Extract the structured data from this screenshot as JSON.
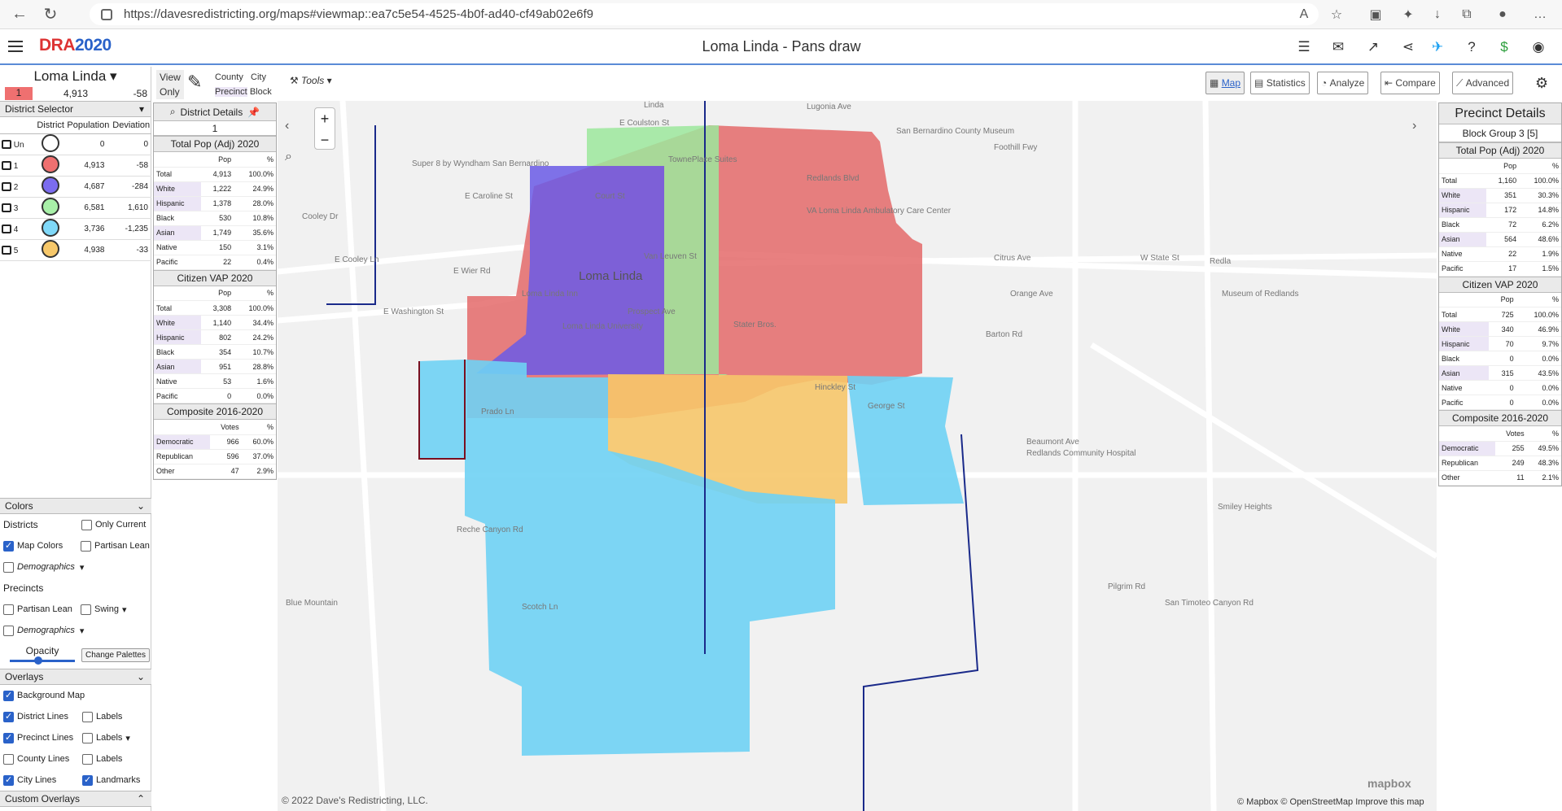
{
  "browser": {
    "url": "https://davesredistricting.org/maps#viewmap::ea7c5e54-4525-4b0f-ad40-cf49ab02e6f9"
  },
  "app": {
    "logo_main": "DRA",
    "logo_year": "2020",
    "title": "Loma Linda - Pans draw"
  },
  "left": {
    "district_name": "Loma Linda",
    "selected_district": "1",
    "selected_pop": "4,913",
    "selected_dev": "-58",
    "selector_title": "District Selector",
    "col_district": "District",
    "col_population": "Population",
    "col_deviation": "Deviation",
    "districts": [
      {
        "id": "Un",
        "pop": "0",
        "dev": "0",
        "color": "#ffffff"
      },
      {
        "id": "1",
        "pop": "4,913",
        "dev": "-58",
        "color": "#ef7070"
      },
      {
        "id": "2",
        "pop": "4,687",
        "dev": "-284",
        "color": "#7b6cf0"
      },
      {
        "id": "3",
        "pop": "6,581",
        "dev": "1,610",
        "color": "#a8f0a8"
      },
      {
        "id": "4",
        "pop": "3,736",
        "dev": "-1,235",
        "color": "#7fd8f8"
      },
      {
        "id": "5",
        "pop": "4,938",
        "dev": "-33",
        "color": "#f7c86a"
      }
    ]
  },
  "colors": {
    "title": "Colors",
    "districts_label": "Districts",
    "only_current": "Only Current",
    "map_colors": "Map Colors",
    "partisan_lean": "Partisan Lean",
    "demographics": "Demographics",
    "precincts_label": "Precincts",
    "p_partisan_lean": "Partisan Lean",
    "swing": "Swing",
    "p_demographics": "Demographics",
    "opacity": "Opacity",
    "change_palettes": "Change Palettes"
  },
  "overlays": {
    "title": "Overlays",
    "background_map": "Background Map",
    "district_lines": "District Lines",
    "labels1": "Labels",
    "precinct_lines": "Precinct Lines",
    "labels2": "Labels",
    "county_lines": "County Lines",
    "labels3": "Labels",
    "city_lines": "City Lines",
    "landmarks": "Landmarks",
    "custom_overlays": "Custom Overlays"
  },
  "toolbar": {
    "view": "View",
    "only": "Only",
    "county": "County",
    "city": "City",
    "precinct": "Precinct",
    "block": "Block",
    "tools": "Tools",
    "map": "Map",
    "statistics": "Statistics",
    "analyze": "Analyze",
    "compare": "Compare",
    "advanced": "Advanced"
  },
  "district_details": {
    "title": "District Details",
    "district": "1",
    "totalpop_title": "Total Pop (Adj) 2020",
    "vap_title": "Citizen VAP 2020",
    "composite_title": "Composite 2016-2020",
    "pop_h": "Pop",
    "pct_h": "%",
    "votes_h": "Votes",
    "totalpop": [
      {
        "k": "Total",
        "v": "4,913",
        "p": "100.0%"
      },
      {
        "k": "White",
        "v": "1,222",
        "p": "24.9%"
      },
      {
        "k": "Hispanic",
        "v": "1,378",
        "p": "28.0%"
      },
      {
        "k": "Black",
        "v": "530",
        "p": "10.8%"
      },
      {
        "k": "Asian",
        "v": "1,749",
        "p": "35.6%"
      },
      {
        "k": "Native",
        "v": "150",
        "p": "3.1%"
      },
      {
        "k": "Pacific",
        "v": "22",
        "p": "0.4%"
      }
    ],
    "vap": [
      {
        "k": "Total",
        "v": "3,308",
        "p": "100.0%"
      },
      {
        "k": "White",
        "v": "1,140",
        "p": "34.4%"
      },
      {
        "k": "Hispanic",
        "v": "802",
        "p": "24.2%"
      },
      {
        "k": "Black",
        "v": "354",
        "p": "10.7%"
      },
      {
        "k": "Asian",
        "v": "951",
        "p": "28.8%"
      },
      {
        "k": "Native",
        "v": "53",
        "p": "1.6%"
      },
      {
        "k": "Pacific",
        "v": "0",
        "p": "0.0%"
      }
    ],
    "composite": [
      {
        "k": "Democratic",
        "v": "966",
        "p": "60.0%"
      },
      {
        "k": "Republican",
        "v": "596",
        "p": "37.0%"
      },
      {
        "k": "Other",
        "v": "47",
        "p": "2.9%"
      }
    ]
  },
  "precinct_details": {
    "title": "Precinct Details",
    "subtitle": "Block Group 3 [5]",
    "totalpop_title": "Total Pop (Adj) 2020",
    "vap_title": "Citizen VAP 2020",
    "composite_title": "Composite 2016-2020",
    "pop_h": "Pop",
    "pct_h": "%",
    "votes_h": "Votes",
    "totalpop": [
      {
        "k": "Total",
        "v": "1,160",
        "p": "100.0%"
      },
      {
        "k": "White",
        "v": "351",
        "p": "30.3%"
      },
      {
        "k": "Hispanic",
        "v": "172",
        "p": "14.8%"
      },
      {
        "k": "Black",
        "v": "72",
        "p": "6.2%"
      },
      {
        "k": "Asian",
        "v": "564",
        "p": "48.6%"
      },
      {
        "k": "Native",
        "v": "22",
        "p": "1.9%"
      },
      {
        "k": "Pacific",
        "v": "17",
        "p": "1.5%"
      }
    ],
    "vap": [
      {
        "k": "Total",
        "v": "725",
        "p": "100.0%"
      },
      {
        "k": "White",
        "v": "340",
        "p": "46.9%"
      },
      {
        "k": "Hispanic",
        "v": "70",
        "p": "9.7%"
      },
      {
        "k": "Black",
        "v": "0",
        "p": "0.0%"
      },
      {
        "k": "Asian",
        "v": "315",
        "p": "43.5%"
      },
      {
        "k": "Native",
        "v": "0",
        "p": "0.0%"
      },
      {
        "k": "Pacific",
        "v": "0",
        "p": "0.0%"
      }
    ],
    "composite": [
      {
        "k": "Democratic",
        "v": "255",
        "p": "49.5%"
      },
      {
        "k": "Republican",
        "v": "249",
        "p": "48.3%"
      },
      {
        "k": "Other",
        "v": "11",
        "p": "2.1%"
      }
    ]
  },
  "map": {
    "labels": [
      "Linda",
      "Lugonia Ave",
      "E Coulston St",
      "San Bernardino County Museum",
      "Foothill Fwy",
      "Super 8 by Wyndham San Bernardino",
      "TownePlace Suites",
      "Redlands Blvd",
      "VA Loma Linda Ambulatory Care Center",
      "E Caroline St",
      "Court St",
      "Cooley Dr",
      "E Cooley Ln",
      "Van Leuven St",
      "Citrus Ave",
      "W State St",
      "Redla",
      "E Wier Rd",
      "Loma Linda",
      "Loma Linda Inn",
      "Orange Ave",
      "Museum of Redlands",
      "E Washington St",
      "Prospect Ave",
      "Loma Linda University",
      "Stater Bros.",
      "Barton Rd",
      "Hinckley St",
      "George St",
      "Beaumont Ave",
      "Redlands Community Hospital",
      "Smiley Heights",
      "Prado Ln",
      "Reche Canyon Rd",
      "Blue Mountain",
      "Scotch Ln",
      "Pilgrim Rd",
      "San Timoteo Canyon Rd"
    ],
    "copyright": "© 2022 Dave's Redistricting, LLC.",
    "attribution": "© Mapbox © OpenStreetMap  Improve this map",
    "mapbox": "mapbox"
  }
}
